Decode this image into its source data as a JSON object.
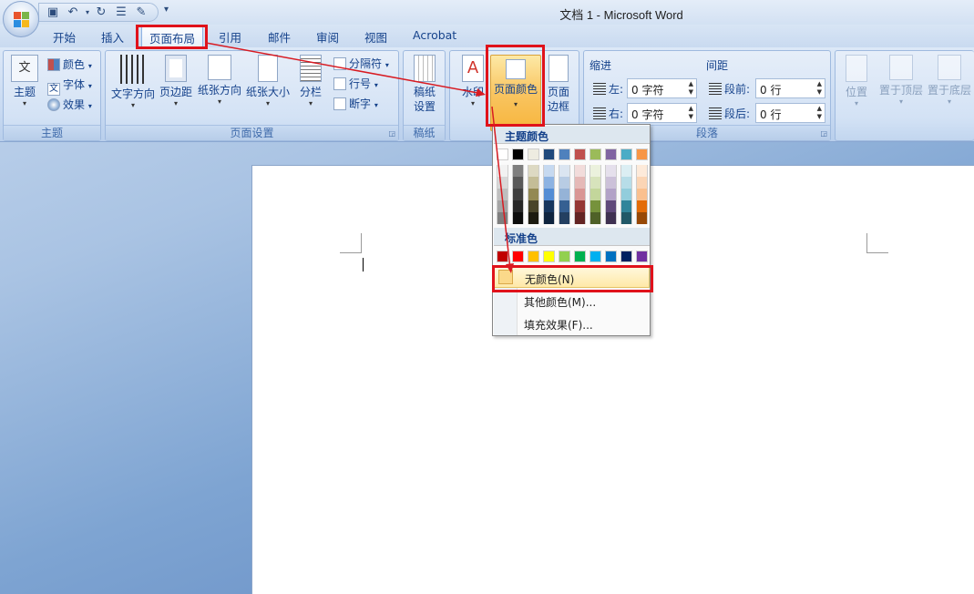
{
  "window": {
    "title": "文档 1 - Microsoft Word"
  },
  "quick_access": {
    "icons": [
      "save-icon",
      "undo-icon",
      "redo-icon",
      "format-icon",
      "edit-icon"
    ],
    "more": "▾"
  },
  "tabs": [
    {
      "label": "开始"
    },
    {
      "label": "插入"
    },
    {
      "label": "页面布局"
    },
    {
      "label": "引用"
    },
    {
      "label": "邮件"
    },
    {
      "label": "审阅"
    },
    {
      "label": "视图"
    },
    {
      "label": "Acrobat"
    }
  ],
  "ribbon": {
    "theme": {
      "label": "主题",
      "main": "主题",
      "colors": "颜色",
      "fonts": "字体",
      "effects": "效果",
      "theme_icon_text": "文"
    },
    "page_setup": {
      "label": "页面设置",
      "text_direction": "文字方向",
      "margins": "页边距",
      "orientation": "纸张方向",
      "size": "纸张大小",
      "columns": "分栏",
      "breaks": "分隔符",
      "line_numbers": "行号",
      "hyphenation": "断字"
    },
    "manuscript": {
      "label": "稿纸",
      "button": "稿纸\n设置",
      "line1": "稿纸",
      "line2": "设置"
    },
    "background": {
      "watermark": "水印",
      "page_color": "页面颜色",
      "page_border_line1": "页面",
      "page_border_line2": "边框"
    },
    "paragraph": {
      "label": "段落",
      "indent": "缩进",
      "spacing": "间距",
      "left_label": "左:",
      "left_value": "0 字符",
      "right_label": "右:",
      "right_value": "0 字符",
      "before_label": "段前:",
      "before_value": "0 行",
      "after_label": "段后:",
      "after_value": "0 行"
    },
    "arrange": {
      "position": "位置",
      "bring_front": "置于顶层",
      "send_back": "置于底层"
    }
  },
  "page_color_menu": {
    "theme_colors_label": "主题颜色",
    "theme_colors_top": [
      "#ffffff",
      "#000000",
      "#eeece1",
      "#1f497d",
      "#4f81bd",
      "#c0504d",
      "#9bbb59",
      "#8064a2",
      "#4bacc6",
      "#f79646"
    ],
    "theme_shades": [
      [
        "#f2f2f2",
        "#d8d8d8",
        "#bfbfbf",
        "#a5a5a5",
        "#7f7f7f"
      ],
      [
        "#7f7f7f",
        "#595959",
        "#3f3f3f",
        "#262626",
        "#0c0c0c"
      ],
      [
        "#ddd9c3",
        "#c4bd97",
        "#938953",
        "#494429",
        "#1d1b10"
      ],
      [
        "#c6d9f0",
        "#8db3e2",
        "#548dd4",
        "#17365d",
        "#0f243e"
      ],
      [
        "#dbe5f1",
        "#b8cce4",
        "#95b3d7",
        "#366092",
        "#244061"
      ],
      [
        "#f2dcdb",
        "#e5b9b7",
        "#d99694",
        "#953734",
        "#632423"
      ],
      [
        "#ebf1dd",
        "#d7e3bc",
        "#c3d69b",
        "#76923c",
        "#4f6128"
      ],
      [
        "#e5e0ec",
        "#ccc1d9",
        "#b2a2c7",
        "#5f497a",
        "#3f3151"
      ],
      [
        "#dbeef3",
        "#b7dde8",
        "#92cddc",
        "#31859b",
        "#205867"
      ],
      [
        "#fdeada",
        "#fbd5b5",
        "#fac08f",
        "#e36c09",
        "#974806"
      ]
    ],
    "standard_colors_label": "标准色",
    "standard_colors": [
      "#c00000",
      "#ff0000",
      "#ffc000",
      "#ffff00",
      "#92d050",
      "#00b050",
      "#00b0f0",
      "#0070c0",
      "#002060",
      "#7030a0"
    ],
    "no_color": "无颜色(N)",
    "more_colors": "其他颜色(M)...",
    "fill_effects": "填充效果(F)..."
  }
}
